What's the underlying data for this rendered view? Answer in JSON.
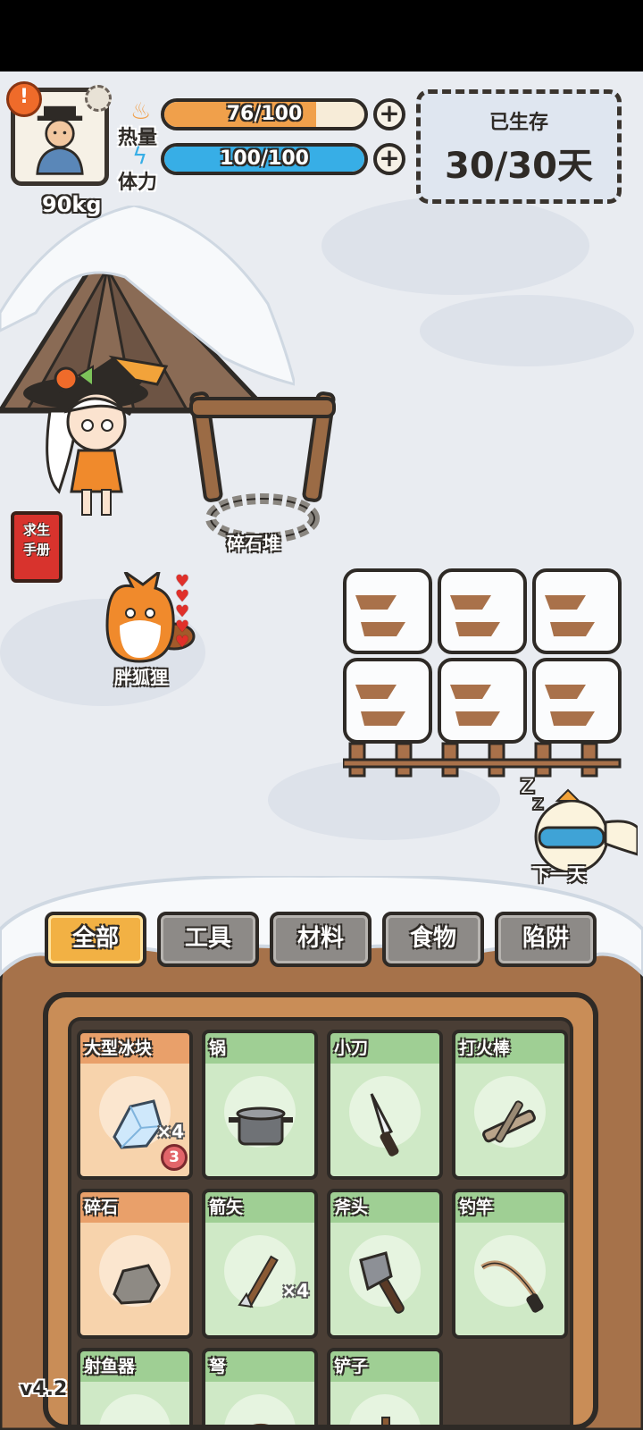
{
  "hud": {
    "alert_badge": "!",
    "weight": "90kg",
    "heat": {
      "label": "热量",
      "text": "76/100",
      "value": 76,
      "max": 100,
      "color": "#f0a04b"
    },
    "stamina": {
      "label": "体力",
      "text": "100/100",
      "value": 100,
      "max": 100,
      "color": "#37aee6"
    },
    "plus_symbol": "+",
    "survived_label": "已生存",
    "survived_value": "30/30天"
  },
  "scene": {
    "manual_line1": "求生",
    "manual_line2": "手册",
    "rubble_label": "碎石堆",
    "fox_label": "胖狐狸",
    "fox_hearts": 5,
    "sleep_label": "下一天"
  },
  "tabs": [
    {
      "label": "全部",
      "active": true
    },
    {
      "label": "工具",
      "active": false
    },
    {
      "label": "材料",
      "active": false
    },
    {
      "label": "食物",
      "active": false
    },
    {
      "label": "陷阱",
      "active": false
    }
  ],
  "items": [
    {
      "name": "大型冰块",
      "style": "orange",
      "icon": "ice-block-icon",
      "qty": "×4",
      "timer": "3"
    },
    {
      "name": "锅",
      "style": "green",
      "icon": "pot-icon",
      "qty": "",
      "timer": ""
    },
    {
      "name": "小刀",
      "style": "green",
      "icon": "knife-icon",
      "qty": "",
      "timer": ""
    },
    {
      "name": "打火棒",
      "style": "green",
      "icon": "fire-drill-icon",
      "qty": "",
      "timer": ""
    },
    {
      "name": "碎石",
      "style": "orange",
      "icon": "rubble-stone-icon",
      "qty": "",
      "timer": ""
    },
    {
      "name": "箭矢",
      "style": "green",
      "icon": "arrow-icon",
      "qty": "×4",
      "timer": ""
    },
    {
      "name": "斧头",
      "style": "green",
      "icon": "axe-icon",
      "qty": "",
      "timer": ""
    },
    {
      "name": "钓竿",
      "style": "green",
      "icon": "fishing-rod-icon",
      "qty": "",
      "timer": ""
    },
    {
      "name": "射鱼器",
      "style": "green",
      "icon": "fish-shooter-icon",
      "qty": "",
      "timer": ""
    },
    {
      "name": "弩",
      "style": "green",
      "icon": "crossbow-icon",
      "qty": "",
      "timer": ""
    },
    {
      "name": "铲子",
      "style": "green",
      "icon": "shovel-icon",
      "qty": "",
      "timer": ""
    }
  ],
  "version": "v4.2"
}
